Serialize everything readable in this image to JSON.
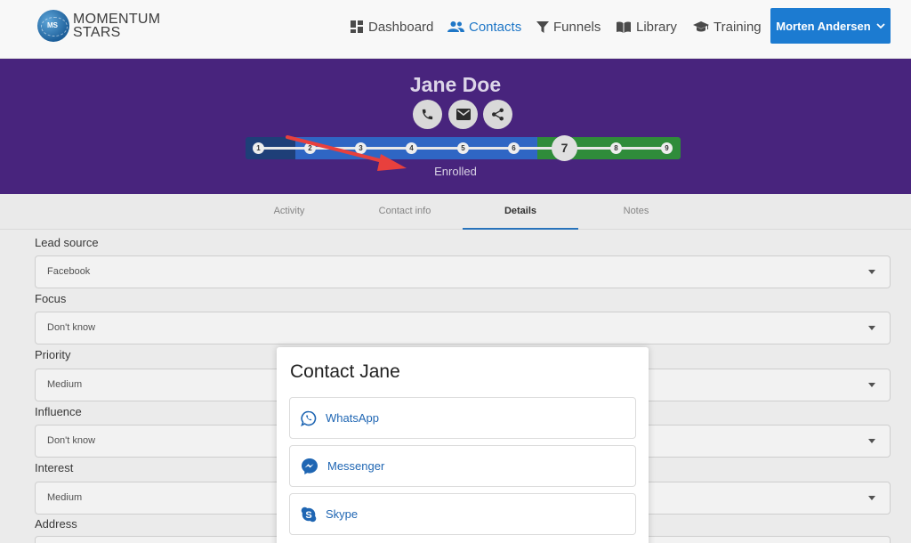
{
  "brand": {
    "line1": "MOMENTUM",
    "line2": "STARS",
    "badge": "MS"
  },
  "nav": {
    "dashboard": "Dashboard",
    "contacts": "Contacts",
    "funnels": "Funnels",
    "library": "Library",
    "training": "Training",
    "user": "Morten Andersen"
  },
  "contact": {
    "name": "Jane Doe",
    "stage": "Enrolled",
    "current_step": "7",
    "steps": [
      "1",
      "2",
      "3",
      "4",
      "5",
      "6",
      "8",
      "9"
    ]
  },
  "tabs": {
    "activity": "Activity",
    "contact_info": "Contact info",
    "details": "Details",
    "notes": "Notes"
  },
  "fields": [
    {
      "label": "Lead source",
      "value": "Facebook"
    },
    {
      "label": "Focus",
      "value": "Don't know"
    },
    {
      "label": "Priority",
      "value": "Medium"
    },
    {
      "label": "Influence",
      "value": "Don't know"
    },
    {
      "label": "Interest",
      "value": "Medium"
    },
    {
      "label": "Address",
      "value": ""
    }
  ],
  "modal": {
    "title": "Contact Jane",
    "options": [
      "WhatsApp",
      "Messenger",
      "Skype"
    ]
  },
  "colors": {
    "header_bg": "#48247d",
    "primary": "#1c7bd1",
    "step_done": "#2f66c4",
    "step_future": "#2f8c3a",
    "step_first": "#1e3f78",
    "arrow": "#e8403d"
  }
}
